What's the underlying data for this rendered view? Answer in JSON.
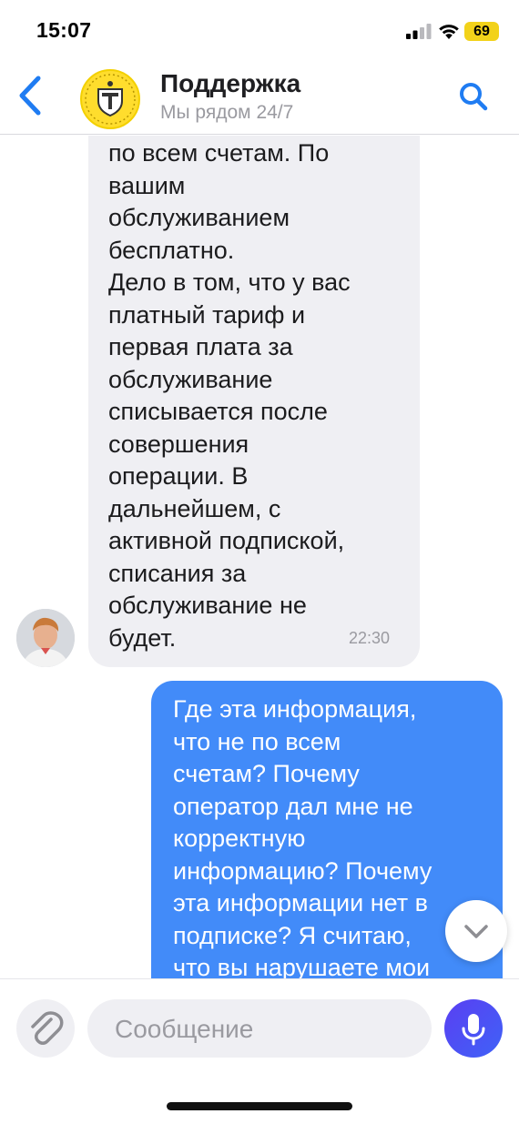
{
  "status_bar": {
    "time": "15:07",
    "battery": "69",
    "battery_color": "#f2d21a"
  },
  "header": {
    "title": "Поддержка",
    "subtitle": "Мы рядом 24/7",
    "accent_color": "#1f7cf2",
    "icons": {
      "back": "chevron-left-icon",
      "search": "search-icon",
      "logo": "bank-logo"
    }
  },
  "messages": [
    {
      "direction": "incoming",
      "text": "по всем счетам. По\nвашим\nобслуживанием\nбесплатно.\nДело в том, что у вас\nплатный тариф и\nпервая плата за\nобслуживание\nсписывается после\nсовершения\nоперации. В\nдальнейшем, с\nактивной подпиской,\nсписания за\nобслуживание не\nбудет.",
      "time": "22:30",
      "bubble_color": "#efeff3"
    },
    {
      "direction": "outgoing",
      "text": "Где эта информация,\nчто не по всем\nсчетам? Почему\nоператор дал мне не\nкорректную\nинформацию? Почему\nэта информации нет в\nподписке? Я считаю,\nчто вы нарушаете мои",
      "bubble_color": "#428bf9"
    }
  ],
  "input": {
    "placeholder": "Сообщение",
    "icons": {
      "attach": "paperclip-icon",
      "mic": "microphone-icon",
      "scroll": "chevron-down-icon"
    },
    "mic_color": "#3d5cf5"
  }
}
